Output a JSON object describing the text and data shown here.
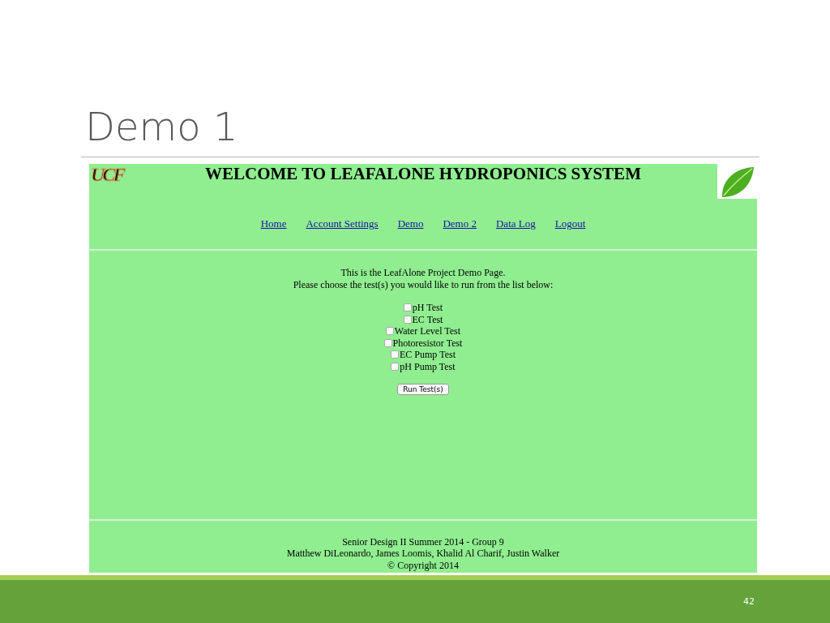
{
  "slide": {
    "title": "Demo 1",
    "page_number": "42"
  },
  "site": {
    "logo": "UCF",
    "heading": "WELCOME TO LEAFALONE HYDROPONICS SYSTEM",
    "nav": [
      {
        "label": "Home"
      },
      {
        "label": "Account Settings"
      },
      {
        "label": "Demo"
      },
      {
        "label": "Demo 2"
      },
      {
        "label": "Data Log"
      },
      {
        "label": "Logout"
      }
    ],
    "intro": [
      "This is the LeafAlone Project Demo Page.",
      "Please choose the test(s) you would like to run from the list below:"
    ],
    "tests": [
      {
        "label": "pH Test",
        "checked": false
      },
      {
        "label": "EC Test",
        "checked": false
      },
      {
        "label": "Water Level Test",
        "checked": false
      },
      {
        "label": "Photoresistor Test",
        "checked": false
      },
      {
        "label": "EC Pump Test",
        "checked": false
      },
      {
        "label": "pH Pump Test",
        "checked": false
      }
    ],
    "run_button": "Run Test(s)",
    "footer": [
      "Senior Design II Summer 2014 - Group 9",
      "Matthew DiLeonardo, James Loomis, Khalid Al Charif, Justin Walker",
      "© Copyright 2014"
    ]
  }
}
